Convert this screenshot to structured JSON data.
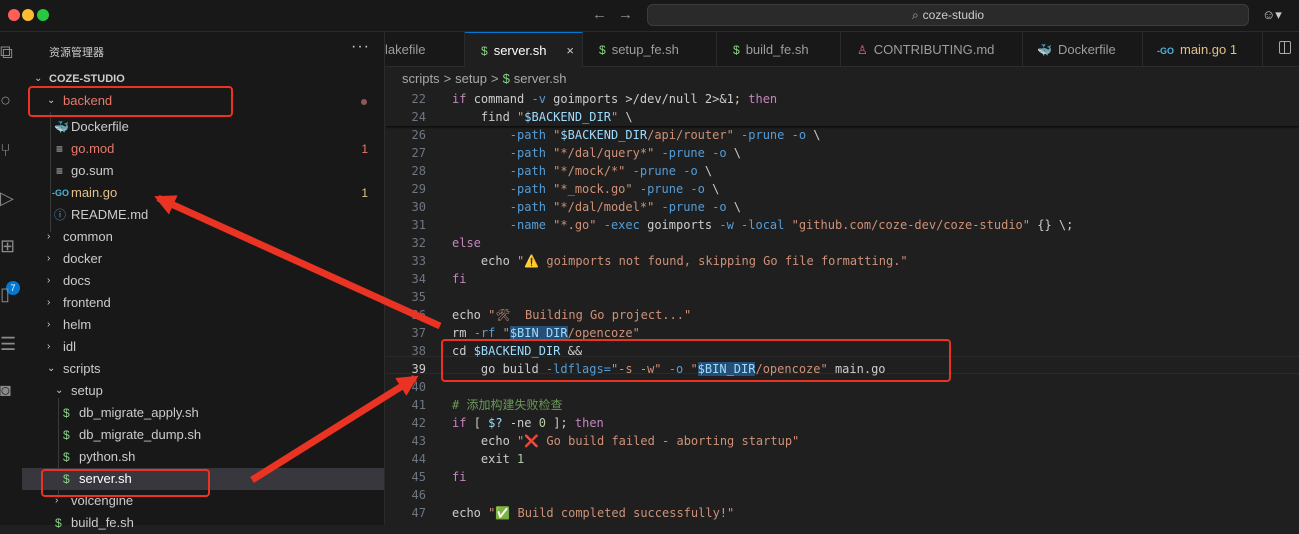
{
  "window": {
    "title": "coze-studio",
    "back_arrow": "←",
    "forward_arrow": "→"
  },
  "activity": {
    "icons": [
      "explorer-icon",
      "search-icon",
      "source-control-icon",
      "run-debug-icon",
      "extensions-icon",
      "book-icon",
      "list-icon",
      "robot-icon"
    ],
    "extensions_badge": "7"
  },
  "sidebar": {
    "title": "资源管理器",
    "more": "···",
    "root": "COZE-STUDIO",
    "items": [
      {
        "label": "backend",
        "badge": ""
      },
      {
        "label": "Dockerfile",
        "badge": ""
      },
      {
        "label": "go.mod",
        "badge": "1"
      },
      {
        "label": "go.sum",
        "badge": ""
      },
      {
        "label": "main.go",
        "badge": "1"
      },
      {
        "label": "README.md",
        "badge": ""
      },
      {
        "label": "common",
        "badge": ""
      },
      {
        "label": "docker",
        "badge": ""
      },
      {
        "label": "docs",
        "badge": ""
      },
      {
        "label": "frontend",
        "badge": ""
      },
      {
        "label": "helm",
        "badge": ""
      },
      {
        "label": "idl",
        "badge": ""
      },
      {
        "label": "scripts",
        "badge": ""
      },
      {
        "label": "setup",
        "badge": ""
      },
      {
        "label": "db_migrate_apply.sh",
        "badge": ""
      },
      {
        "label": "db_migrate_dump.sh",
        "badge": ""
      },
      {
        "label": "python.sh",
        "badge": ""
      },
      {
        "label": "server.sh",
        "badge": ""
      },
      {
        "label": "volcengine",
        "badge": ""
      },
      {
        "label": "build_fe.sh",
        "badge": ""
      }
    ]
  },
  "tabs": [
    {
      "label": "lakefile",
      "icon": ""
    },
    {
      "label": "server.sh",
      "icon": "$",
      "close": "×"
    },
    {
      "label": "setup_fe.sh",
      "icon": "$"
    },
    {
      "label": "build_fe.sh",
      "icon": "$"
    },
    {
      "label": "CONTRIBUTING.md",
      "icon": "♙"
    },
    {
      "label": "Dockerfile",
      "icon": "🐳"
    },
    {
      "label": "main.go 1",
      "icon": "-GO"
    }
  ],
  "breadcrumb": {
    "part1": "scripts",
    "part2": "setup",
    "part3": "server.sh",
    "sep": ">",
    "file_icon": "$"
  },
  "colors": {
    "accent": "#0078d4",
    "annotation_red": "#ea3323",
    "warning_text": "#e2c08d",
    "modified": "#e2c08d"
  },
  "editor": {
    "lines": [
      {
        "n": "22",
        "sticky": true,
        "tokens": [
          [
            "kw",
            "if "
          ],
          [
            "",
            "command "
          ],
          [
            "opt",
            "-v "
          ],
          [
            "",
            "goimports "
          ],
          [
            "",
            "&gt;/dev/null 2&gt;&amp;1; "
          ],
          [
            "kw",
            "then"
          ]
        ]
      },
      {
        "n": "24",
        "sticky": true,
        "tokens": [
          [
            "",
            "    find "
          ],
          [
            "str",
            "\""
          ],
          [
            "var",
            "$BACKEND_DIR"
          ],
          [
            "str",
            "\""
          ],
          [
            "",
            " \\"
          ]
        ]
      },
      {
        "n": "26",
        "tokens": [
          [
            "",
            "        "
          ],
          [
            "opt",
            "-path "
          ],
          [
            "str",
            "\""
          ],
          [
            "var",
            "$BACKEND_DIR"
          ],
          [
            "str",
            "/api/router\" "
          ],
          [
            "opt",
            "-prune -o "
          ],
          [
            "",
            "\\"
          ]
        ]
      },
      {
        "n": "27",
        "tokens": [
          [
            "",
            "        "
          ],
          [
            "opt",
            "-path "
          ],
          [
            "str",
            "\"*/dal/query*\" "
          ],
          [
            "opt",
            "-prune -o "
          ],
          [
            "",
            "\\"
          ]
        ]
      },
      {
        "n": "28",
        "tokens": [
          [
            "",
            "        "
          ],
          [
            "opt",
            "-path "
          ],
          [
            "str",
            "\"*/mock/*\" "
          ],
          [
            "opt",
            "-prune -o "
          ],
          [
            "",
            "\\"
          ]
        ]
      },
      {
        "n": "29",
        "tokens": [
          [
            "",
            "        "
          ],
          [
            "opt",
            "-path "
          ],
          [
            "str",
            "\"*_mock.go\" "
          ],
          [
            "opt",
            "-prune -o "
          ],
          [
            "",
            "\\"
          ]
        ]
      },
      {
        "n": "30",
        "tokens": [
          [
            "",
            "        "
          ],
          [
            "opt",
            "-path "
          ],
          [
            "str",
            "\"*/dal/model*\" "
          ],
          [
            "opt",
            "-prune -o "
          ],
          [
            "",
            "\\"
          ]
        ]
      },
      {
        "n": "31",
        "tokens": [
          [
            "",
            "        "
          ],
          [
            "opt",
            "-name "
          ],
          [
            "str",
            "\"*.go\" "
          ],
          [
            "opt",
            "-exec "
          ],
          [
            "",
            "goimports "
          ],
          [
            "opt",
            "-w -local "
          ],
          [
            "str",
            "\"github.com/coze-dev/coze-studio\" "
          ],
          [
            "",
            "{} \\;"
          ]
        ]
      },
      {
        "n": "32",
        "tokens": [
          [
            "kw",
            "else"
          ]
        ]
      },
      {
        "n": "33",
        "tokens": [
          [
            "",
            "    echo "
          ],
          [
            "str",
            "\"⚠️ goimports not found, skipping Go file formatting.\""
          ]
        ]
      },
      {
        "n": "34",
        "tokens": [
          [
            "kw",
            "fi"
          ]
        ]
      },
      {
        "n": "35",
        "tokens": []
      },
      {
        "n": "36",
        "tokens": [
          [
            "",
            "echo "
          ],
          [
            "str",
            "\"🛠  Building Go project...\""
          ]
        ]
      },
      {
        "n": "37",
        "tokens": [
          [
            "",
            "rm "
          ],
          [
            "opt",
            "-rf "
          ],
          [
            "str",
            "\""
          ],
          [
            "hlv",
            "$BIN_DIR"
          ],
          [
            "str",
            "/opencoze\""
          ]
        ]
      },
      {
        "n": "38",
        "tokens": [
          [
            "",
            "cd "
          ],
          [
            "var",
            "$BACKEND_DIR "
          ],
          [
            "",
            "&amp;&amp;"
          ]
        ]
      },
      {
        "n": "39",
        "cur": true,
        "tokens": [
          [
            "",
            "    go build "
          ],
          [
            "opt",
            "-ldflags="
          ],
          [
            "str",
            "\"-s -w\" "
          ],
          [
            "opt",
            "-o "
          ],
          [
            "str",
            "\""
          ],
          [
            "hlv",
            "$BIN_DIR"
          ],
          [
            "str",
            "/opencoze\" "
          ],
          [
            "",
            "main.go"
          ]
        ]
      },
      {
        "n": "40",
        "tokens": []
      },
      {
        "n": "41",
        "tokens": [
          [
            "cm",
            "# 添加构建失败检查"
          ]
        ]
      },
      {
        "n": "42",
        "tokens": [
          [
            "kw",
            "if "
          ],
          [
            "",
            "[ "
          ],
          [
            "var",
            "$? "
          ],
          [
            "",
            "-ne "
          ],
          [
            "num",
            "0 "
          ],
          [
            "",
            "]; "
          ],
          [
            "kw",
            "then"
          ]
        ]
      },
      {
        "n": "43",
        "tokens": [
          [
            "",
            "    echo "
          ],
          [
            "str",
            "\"❌ Go build failed - aborting startup\""
          ]
        ]
      },
      {
        "n": "44",
        "tokens": [
          [
            "",
            "    exit "
          ],
          [
            "num",
            "1"
          ]
        ]
      },
      {
        "n": "45",
        "tokens": [
          [
            "kw",
            "fi"
          ]
        ]
      },
      {
        "n": "46",
        "tokens": []
      },
      {
        "n": "47",
        "tokens": [
          [
            "",
            "echo "
          ],
          [
            "str",
            "\"✅ Build completed successfully!\""
          ]
        ]
      }
    ]
  }
}
